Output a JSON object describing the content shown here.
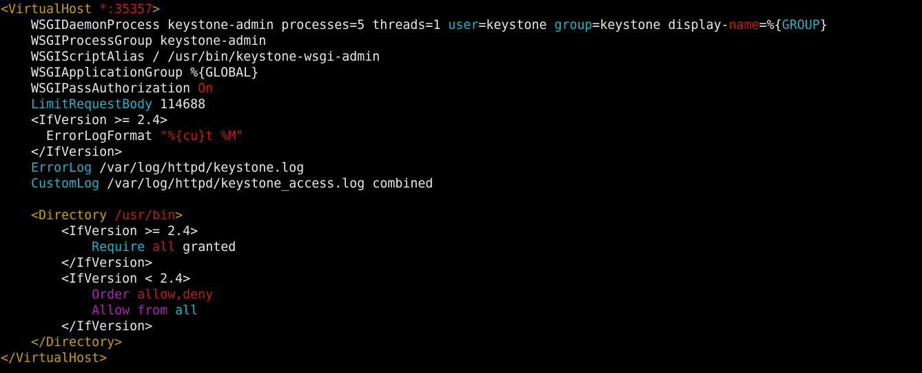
{
  "colors": {
    "background": "#000000",
    "default": "#e8e8e8",
    "yellow": "#c8a000",
    "red": "#c01c1c",
    "cyan": "#20b2c8",
    "magenta": "#b020b8"
  },
  "lines": [
    [
      {
        "t": "<VirtualHost",
        "c": "yellow"
      },
      {
        "t": " *:35357",
        "c": "red"
      },
      {
        "t": ">",
        "c": "yellow"
      }
    ],
    [
      {
        "t": "    WSGIDaemonProcess keystone-admin processes=5 threads=1 ",
        "c": "default"
      },
      {
        "t": "user",
        "c": "cyan"
      },
      {
        "t": "=keystone ",
        "c": "default"
      },
      {
        "t": "group",
        "c": "cyan"
      },
      {
        "t": "=keystone display-",
        "c": "default"
      },
      {
        "t": "name",
        "c": "red"
      },
      {
        "t": "=%{",
        "c": "default"
      },
      {
        "t": "GROUP",
        "c": "cyan"
      },
      {
        "t": "}",
        "c": "default"
      }
    ],
    [
      {
        "t": "    WSGIProcessGroup keystone-admin",
        "c": "default"
      }
    ],
    [
      {
        "t": "    WSGIScriptAlias / /usr/bin/keystone-wsgi-admin",
        "c": "default"
      }
    ],
    [
      {
        "t": "    WSGIApplicationGroup %{GLOBAL}",
        "c": "default"
      }
    ],
    [
      {
        "t": "    WSGIPassAuthorization ",
        "c": "default"
      },
      {
        "t": "On",
        "c": "red"
      }
    ],
    [
      {
        "t": "    ",
        "c": "default"
      },
      {
        "t": "LimitRequestBody",
        "c": "cyan"
      },
      {
        "t": " 114688",
        "c": "default"
      }
    ],
    [
      {
        "t": "    <IfVersion >= 2.4>",
        "c": "default"
      }
    ],
    [
      {
        "t": "      ErrorLogFormat ",
        "c": "default"
      },
      {
        "t": "\"%{cu}t %M\"",
        "c": "red"
      }
    ],
    [
      {
        "t": "    </IfVersion>",
        "c": "default"
      }
    ],
    [
      {
        "t": "    ",
        "c": "default"
      },
      {
        "t": "ErrorLog",
        "c": "cyan"
      },
      {
        "t": " /var/log/httpd/keystone.log",
        "c": "default"
      }
    ],
    [
      {
        "t": "    ",
        "c": "default"
      },
      {
        "t": "CustomLog",
        "c": "cyan"
      },
      {
        "t": " /var/log/httpd/keystone_access.log combined",
        "c": "default"
      }
    ],
    [],
    [
      {
        "t": "    ",
        "c": "default"
      },
      {
        "t": "<Directory",
        "c": "yellow"
      },
      {
        "t": " /usr/bin",
        "c": "red"
      },
      {
        "t": ">",
        "c": "yellow"
      }
    ],
    [
      {
        "t": "        <IfVersion >= 2.4>",
        "c": "default"
      }
    ],
    [
      {
        "t": "            ",
        "c": "default"
      },
      {
        "t": "Require",
        "c": "cyan"
      },
      {
        "t": " ",
        "c": "default"
      },
      {
        "t": "all",
        "c": "red"
      },
      {
        "t": " granted",
        "c": "default"
      }
    ],
    [
      {
        "t": "        </IfVersion>",
        "c": "default"
      }
    ],
    [
      {
        "t": "        <IfVersion < 2.4>",
        "c": "default"
      }
    ],
    [
      {
        "t": "            ",
        "c": "default"
      },
      {
        "t": "Order",
        "c": "magenta"
      },
      {
        "t": " ",
        "c": "default"
      },
      {
        "t": "allow,deny",
        "c": "red"
      }
    ],
    [
      {
        "t": "            ",
        "c": "default"
      },
      {
        "t": "Allow from",
        "c": "magenta"
      },
      {
        "t": " ",
        "c": "default"
      },
      {
        "t": "all",
        "c": "cyan"
      }
    ],
    [
      {
        "t": "        </IfVersion>",
        "c": "default"
      }
    ],
    [
      {
        "t": "    ",
        "c": "default"
      },
      {
        "t": "</Directory>",
        "c": "yellow"
      }
    ],
    [
      {
        "t": "</VirtualHost>",
        "c": "yellow"
      }
    ]
  ]
}
